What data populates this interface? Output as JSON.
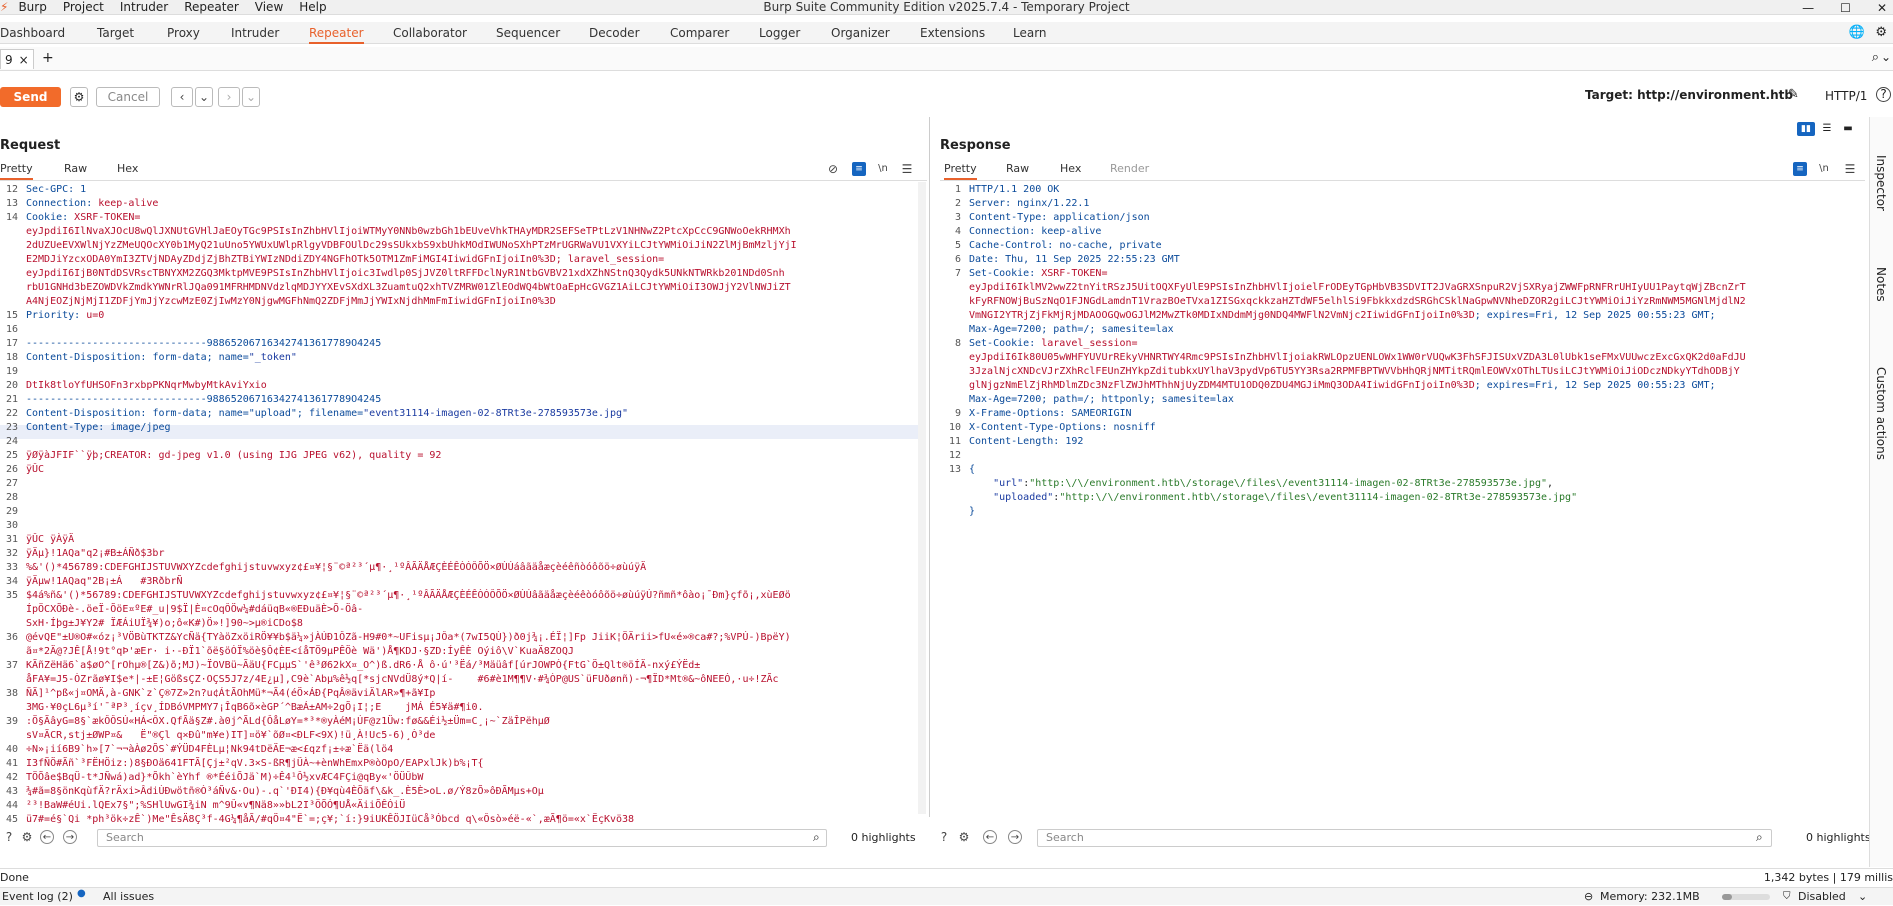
{
  "titlebar": {
    "menus": [
      "Burp",
      "Project",
      "Intruder",
      "Repeater",
      "View",
      "Help"
    ],
    "title": "Burp Suite Community Edition v2025.7.4 - Temporary Project"
  },
  "tabs": [
    "Dashboard",
    "Target",
    "Proxy",
    "Intruder",
    "Repeater",
    "Collaborator",
    "Sequencer",
    "Decoder",
    "Comparer",
    "Logger",
    "Organizer",
    "Extensions",
    "Learn"
  ],
  "active_tab": "Repeater",
  "subtab": {
    "label": "9",
    "close": "×",
    "add": "+"
  },
  "toolbar": {
    "send_label": "Send",
    "cancel_label": "Cancel",
    "target_label": "Target: http://environment.htb",
    "http_version": "HTTP/1"
  },
  "request": {
    "title": "Request",
    "tabs": [
      "Pretty",
      "Raw",
      "Hex"
    ],
    "active": "Pretty",
    "wrap_glyph": "\\n",
    "lines": [
      {
        "n": "12",
        "text": "Sec-GPC: 1"
      },
      {
        "n": "13",
        "key": "Connection: ",
        "val": "keep-alive"
      },
      {
        "n": "14",
        "key": "Cookie: ",
        "val": "XSRF-TOKEN="
      },
      {
        "n": "",
        "val": "eyJpdiI6IlNvaXJOcU8wQlJXNUtGVHlJaEOyTGc9PSIsInZhbHVlIjoiWTMyY0NNb0wzbGh1bEUveVhkTHAyMDR2SEFSeTPtLzV1NHNwZ2PtcXpCcC9GNWoOekRHMXh"
      },
      {
        "n": "",
        "val": "2dUZUeEVXWlNjYzZMeUQOcXY0b1MyQ21uUno5YWUxUWlpRlgyVDBFOUlDc29sSUkxbS9xbUhkMOdIWUNoSXhPTzMrUGRWaVU1VXYiLCJtYWMiOiJiN2ZlMjBmMzljYjI"
      },
      {
        "n": "",
        "val": "E2MDJiYzcxODA0YmI3ZTVjNDAyZDdjZjBhZTBiYWIzNDdiZDY4NGFhOTk5OTM1ZmFiMGI4IiwidGFnIjoiIn0%3D; laravel_session="
      },
      {
        "n": "",
        "val": "eyJpdiI6IjB0NTdDSVRscTBNYXM2ZGQ3MktpMVE9PSIsInZhbHVlIjoic3Iwdlp0SjJVZ0ltRFFDclNyR1NtbGVBV21xdXZhNStnQ3Qydk5UNkNTWRkb201NDd0Snh"
      },
      {
        "n": "",
        "val": "rbU1GNHd3bEZOWDVkZmdkYWNrRlJQa091MFRHMDNVdzlqMDJYYXEvSXdXL3ZuamtuQ2xhTVZMRW01ZlEOdWQ4bWtOaEpHcGVGZ1AiLCJtYWMiOiI3OWJjY2VlNWJiZT"
      },
      {
        "n": "",
        "val": "A4NjEOZjNjMjI1ZDFjYmJjYzcwMzE0ZjIwMzY0NjgwMGFhNmQ2ZDFjMmJjYWIxNjdhMmFmIiwidGFnIjoiIn0%3D"
      },
      {
        "n": "15",
        "key": "Priority: ",
        "val": "u=0"
      },
      {
        "n": "16",
        "text": ""
      },
      {
        "n": "17",
        "text": "------------------------------988652067163427413617789O4245"
      },
      {
        "n": "18",
        "key": "Content-Disposition: ",
        "text2": "form-data; name=",
        "q": "\"_token\""
      },
      {
        "n": "19",
        "text": ""
      },
      {
        "n": "20",
        "val": "DtIk8tloYfUHSOFn3rxbpPKNqrMwbyMtkAviYxio"
      },
      {
        "n": "21",
        "text": "------------------------------988652067163427413617789O4245"
      },
      {
        "n": "22",
        "key": "Content-Disposition: ",
        "text2": "form-data; name=\"upload\"; filename=",
        "q": "\"event31114-imagen-02-8TRt3e-278593573e.jpg\""
      },
      {
        "n": "23",
        "key": "Content-Type: ",
        "text2": "image/jpeg"
      },
      {
        "n": "24",
        "text": ""
      },
      {
        "n": "25",
        "val": "ÿØÿàJFIF``ÿþ;CREATOR: gd-jpeg v1.0 (using IJG JPEG v62), quality = 92"
      },
      {
        "n": "26",
        "val": "ÿÛC"
      },
      {
        "n": "27",
        "text": ""
      },
      {
        "n": "28",
        "text": ""
      },
      {
        "n": "29",
        "text": ""
      },
      {
        "n": "30",
        "text": ""
      },
      {
        "n": "31",
        "val": "ÿÛC ÿÀÿÄ"
      },
      {
        "n": "32",
        "val": "ÿÄµ}!1AQa\"q2¡#B±ÁÑð$3br"
      },
      {
        "n": "33",
        "val": "%&'()*456789:CDEFGHIJSTUVWXYZcdefghijstuvwxyz¢£¤¥¦§¨©ª²³´µ¶·¸¹ºÂÃÄÅÆÇÈÉÊÒÓÔÕÖ×ØÙÚáâãäåæçèéêñòóôõö÷øùúÿÄ"
      },
      {
        "n": "34",
        "val": "ÿÄµw!1AQaq\"2B¡±Á   #3RðbrÑ"
      },
      {
        "n": "35",
        "val": "$4á%ñ&'()*56789:CDEFGHIJSTUVWXYZcdefghijstuvwxyz¢£¤¥¦§¨©ª²³´µ¶·¸¹ºÂÃÄÅÆÇÈÉÊÒÓÔÕÖ×ØÙÚâãäåæçèéêòóôõö÷øùúÿÚ?ñmñ*ôào¡¯Ðm}çfõ¡,xùEØö"
      },
      {
        "n": "",
        "val": "ÍpÖCXÕÐè-.öeÏ-ÕöE¤ºE#_u|9$Ï|È¤cOqÔÖw¼#dáüqB«®EÐuäÈ>Õ-Öâ-"
      },
      {
        "n": "",
        "val": "SxH·Íþg±J¥Y2# ÏÆÁiUÏ¾¥)o;ô«K#)Ö»!]90~>µ®iCDo$8"
      },
      {
        "n": "36",
        "val": "@évQE\"±U®O#«óz¡³VÖBùTKTZ&YcÑä{TYàöZxöiRÖ¥¥b$ä¼»jÀÚÐ1ÔZã-H9#0*~UFisµ¡JÔa*(7wI5QÙ})ð0j¾¡.ÉÏ¦]Fp JiiK¦ÖÄrii>fU«é»®ca#?;%VPÚ-)BpëY)"
      },
      {
        "n": "",
        "val": "ã¤*2Ä@?JÊ[Å!9t°qÞ'æEr· i·-ÐÏ1`õë§öÓÏ%öè§Ô¢ÈE<íåTÖ9µPÊÖè Wä')Å¶KDJ·§ZD:ÍyÊÈ Oýiô\\V`KuaÄ8ZOQJ"
      },
      {
        "n": "37",
        "val": "KÃñZëHä6`a$øO^[rOhµ®[Z&)õ;MJ)~ÏOVBü~ÃäU{FCµµS`'ê³Ø62kX¤_O^)ß.dR6·Å ô·ú'³Ëá/³Mäüâf[úrJOWPÒ{FtG`Ö±Qlt®öÍÄ-nxý£ÝËd±"
      },
      {
        "n": "",
        "val": "åFA¥=J5-ÒZrãø¥I$e*|-±E¦GößsÇZ·OÇS5J7z/4E¿µ],C9è`Abµ%ê½q[*sjcNVdÜ8ý*Q|í-    #6#è1M¶¶V·#¾ÒP@US`üFUðønñ)-¬¶ÏD*Mt®&~ôNEEÓ,·u÷!ZÃc"
      },
      {
        "n": "38",
        "val": "ÑÃ]¹^pß«j¤OMÄ,à-GNK`z`Ç®7Z»2n?u¢ÁtÃOhMü*¬Ã4(éÖ×ÁÐ{PqÂ®äviÄlAR»¶+ã¥Ip"
      },
      {
        "n": "",
        "val": "3MG·¥0çL6µ³í'¯ªP³¸íçv¸ÍDBóVMPMY7¡ÎqB6õ×èGP´^BæÁ±AM÷2gÕ¡I¦;E    jMÁ É5¥ä#¶i0."
      },
      {
        "n": "39",
        "val": ":Ö§ÃâyG=8§`ækÔÔSÚ«HÁ<ÔX.QfÃä§Z#.à0j^ÃLd{ÔåLøY=*³*®yÀéM¡ÚF@z1Üw:fø&&Éi½±Üm=C¸¡~`ZäÎPëhµØ"
      },
      {
        "n": "",
        "val": "sV¤ÃCR,stj±ØWP¤&   Ë\"®Çl q×Ðû\"m¥e)IT]¤ö¥`õØ¤<ÐLF<9X)!ü¸À!Uc5-6)¸Ò³de"
      },
      {
        "n": "40",
        "val": "÷N»¡ií6B9`h»[7`¬¬àÀø2ÕS`#ÝÜD4FÈLµ¦Nk94tDëÄE¬æ<£qzf¡±÷æ`Ëä(lö4"
      },
      {
        "n": "41",
        "val": "I3fÑÖ#Ãñ`³FËHÖiz:)8§ÐOä641FTÃ[Çj±²qV.3×S-ßR¶jÜÀ~+ènWhEmxP®òOpO/EAPxlJk)b%¡T{"
      },
      {
        "n": "42",
        "val": "TÖÕâe$BqÜ-t*JÑwá)ad}*Õkh`èYhf ®*ÉéiÕJä`M)÷Ê4¹Ô½xvÆC4FÇi@qBy«'ÖÜÛbW"
      },
      {
        "n": "43",
        "val": "¾#ã=8§önKqùfÄ?rÄxi>ÂdiÙÐwötñ®Ò³áÑv&·Ou)-.q`'ÐI4){Ð¥qù4ÈÕäf\\&k_.È5È>oL.ø/Ý8zÕ»ôÐÃMµs+Oµ"
      },
      {
        "n": "44",
        "val": "²³!BaW#éUi.lQEx7§\";%SHlUwGI¾iN m^9Û«v¶Nä8»»bL2I³ÖÕÓ¶UÅ«ÄiiÕÊÓiÜ"
      },
      {
        "n": "45",
        "val": "ü7#=é§`Qi *ph³ök÷zÊ`)Me\"ÊsÄ8Ç³f-4G¼¶åÃ/#qÖ¤4\"Ë`=;ç¥;`í:}9iUKÊÖJIüCå³Óbcd q\\«Ôsò»éë-«`,æÃ¶ö=«x`ËçKvö38"
      }
    ],
    "search_placeholder": "Search",
    "highlights": "0 highlights"
  },
  "response": {
    "title": "Response",
    "tabs": [
      "Pretty",
      "Raw",
      "Hex",
      "Render"
    ],
    "active": "Pretty",
    "lines": [
      {
        "n": "1",
        "text": "HTTP/1.1 200 OK"
      },
      {
        "n": "2",
        "key": "Server: ",
        "text2": "nginx/1.22.1"
      },
      {
        "n": "3",
        "key": "Content-Type: ",
        "text2": "application/json"
      },
      {
        "n": "4",
        "key": "Connection: ",
        "text2": "keep-alive"
      },
      {
        "n": "5",
        "key": "Cache-Control: ",
        "text2": "no-cache, private"
      },
      {
        "n": "6",
        "key": "Date: ",
        "text2": "Thu, 11 Sep 2025 22:55:23 GMT"
      },
      {
        "n": "7",
        "key": "Set-Cookie: ",
        "val": "XSRF-TOKEN="
      },
      {
        "n": "",
        "val": "eyJpdiI6IklMV2wwZ2tnYitRSzJ5UitOQXFyUlE9PSIsInZhbHVlIjoielFrODEyTGpHbVB3SDVIT2JVaGRXSnpuR2VjSXRyajZWWFpRNFRrUHIyUU1PaytqWjZBcnZrT"
      },
      {
        "n": "",
        "val": "kFyRFNOWjBuSzNqO1FJNGdLamdnT1VrazBOeTVxa1ZISGxqckkzaHZTdWF5elhlSi9FbkkxdzdSRGhCSklNaGpwNVNheDZOR2giLCJtYWMiOiJiYzRmNWM5MGNlMjdlN2"
      },
      {
        "n": "",
        "val": "VmNGI2YTRjZjFkMjRjMDAOOGQwOGJlM2MwZTk0MDIxNDdmMjg0NDQ4MWFlN2VmNjc2IiwidGFnIjoiIn0%3D",
        "tail": "; expires=Fri, 12 Sep 2025 00:55:23 GMT;"
      },
      {
        "n": "",
        "text": "Max-Age=7200; path=/; samesite=lax"
      },
      {
        "n": "8",
        "key": "Set-Cookie: ",
        "val": "laravel_session="
      },
      {
        "n": "",
        "val": "eyJpdiI6Ik80U05wWHFYUVUrREkyVHNRTWY4Rmc9PSIsInZhbHVlIjoiakRWLOpzUENLOWx1WW0rVUQwK3FhSFJISUxVZDA3L0lUbk1seFMxVUUwczExcGxQK2d0aFdJU"
      },
      {
        "n": "",
        "val": "3JzalNjcXNDcVJrZXhRclFEUnZHYkpZditubkxUYlhaV3pydVp6TU5YY3Rsa2RPMFBPTWVVbHhQRjNMTitRQmlEOWVxOThLTUsiLCJtYWMiOiJiODczNDkyYTdhODBjY"
      },
      {
        "n": "",
        "val": "glNjgzNmElZjRhMDlmZDc3NzFlZWJhMThhNjUyZDM4MTU1ODQ0ZDU4MGJiMmQ3ODA4IiwidGFnIjoiIn0%3D",
        "tail": "; expires=Fri, 12 Sep 2025 00:55:23 GMT;"
      },
      {
        "n": "",
        "text": "Max-Age=7200; path=/; httponly; samesite=lax"
      },
      {
        "n": "9",
        "key": "X-Frame-Options: ",
        "text2": "SAMEORIGIN"
      },
      {
        "n": "10",
        "key": "X-Content-Type-Options: ",
        "text2": "nosniff"
      },
      {
        "n": "11",
        "key": "Content-Length: ",
        "text2": "192"
      },
      {
        "n": "12",
        "text": ""
      },
      {
        "n": "13",
        "text": "{"
      },
      {
        "n": "",
        "json_key": "    \"url\"",
        "sep": ":",
        "json_val": "\"http:\\/\\/environment.htb\\/storage\\/files\\/event31114-imagen-02-8TRt3e-278593573e.jpg\"",
        "end": ","
      },
      {
        "n": "",
        "json_key": "    \"uploaded\"",
        "sep": ":",
        "json_val": "\"http:\\/\\/environment.htb\\/storage\\/files\\/event31114-imagen-02-8TRt3e-278593573e.jpg\"",
        "end": ""
      },
      {
        "n": "",
        "text": "}"
      }
    ],
    "search_placeholder": "Search",
    "highlights": "0 highlights"
  },
  "side_panel": [
    "Inspector",
    "Notes",
    "Custom actions"
  ],
  "status": {
    "left": "Done",
    "right": "1,342 bytes | 179 millis"
  },
  "bottom": {
    "event_log": "Event log (2)",
    "all_issues": "All issues",
    "memory": "Memory: 232.1MB",
    "disabled": "Disabled"
  },
  "colors": {
    "accent": "#e8612c",
    "send": "#f26b2a",
    "key": "#0a4a9a",
    "value": "#b8102e"
  }
}
